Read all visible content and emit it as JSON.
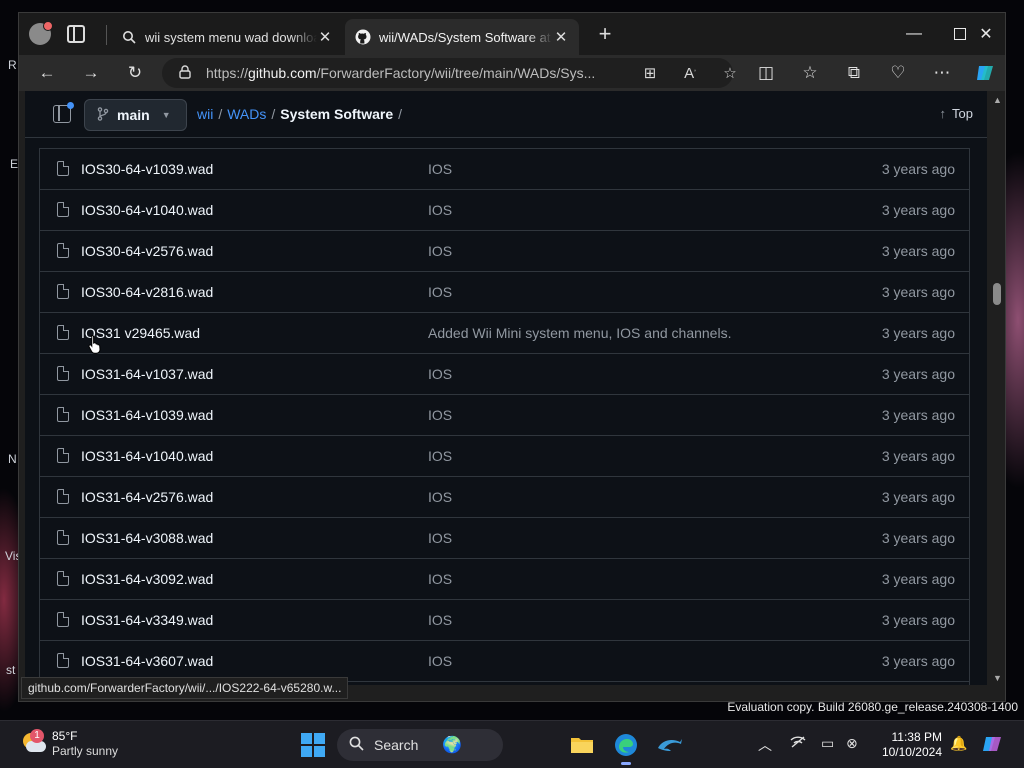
{
  "browser": {
    "tabs": [
      {
        "title": "wii system menu wad download -",
        "icon": "search-icon",
        "active": false
      },
      {
        "title": "wii/WADs/System Software at ma",
        "icon": "github-icon",
        "active": true
      }
    ],
    "address": {
      "url_prefix": "https://",
      "url_host": "github.com",
      "url_path": "/ForwarderFactory/wii/tree/main/WADs/Sys..."
    },
    "status_url": "github.com/ForwarderFactory/wii/.../IOS222-64-v65280.w..."
  },
  "repo_header": {
    "branch": "main",
    "breadcrumb": [
      "wii",
      "WADs",
      "System Software"
    ],
    "top_label": "Top"
  },
  "files": [
    {
      "name": "IOS30-64-v1039.wad",
      "message": "IOS",
      "age": "3 years ago"
    },
    {
      "name": "IOS30-64-v1040.wad",
      "message": "IOS",
      "age": "3 years ago"
    },
    {
      "name": "IOS30-64-v2576.wad",
      "message": "IOS",
      "age": "3 years ago"
    },
    {
      "name": "IOS30-64-v2816.wad",
      "message": "IOS",
      "age": "3 years ago"
    },
    {
      "name": "IOS31 v29465.wad",
      "message": "Added Wii Mini system menu, IOS and channels.",
      "age": "3 years ago"
    },
    {
      "name": "IOS31-64-v1037.wad",
      "message": "IOS",
      "age": "3 years ago"
    },
    {
      "name": "IOS31-64-v1039.wad",
      "message": "IOS",
      "age": "3 years ago"
    },
    {
      "name": "IOS31-64-v1040.wad",
      "message": "IOS",
      "age": "3 years ago"
    },
    {
      "name": "IOS31-64-v2576.wad",
      "message": "IOS",
      "age": "3 years ago"
    },
    {
      "name": "IOS31-64-v3088.wad",
      "message": "IOS",
      "age": "3 years ago"
    },
    {
      "name": "IOS31-64-v3092.wad",
      "message": "IOS",
      "age": "3 years ago"
    },
    {
      "name": "IOS31-64-v3349.wad",
      "message": "IOS",
      "age": "3 years ago"
    },
    {
      "name": "IOS31-64-v3607.wad",
      "message": "IOS",
      "age": "3 years ago"
    }
  ],
  "desktop": {
    "watermark": "Evaluation copy. Build 26080.ge_release.240308-1400"
  },
  "taskbar": {
    "weather_temp": "85°F",
    "weather_condition": "Partly sunny",
    "weather_badge": "1",
    "search_label": "Search",
    "time": "11:38 PM",
    "date": "10/10/2024"
  },
  "colors": {
    "page_bg": "#0d1117",
    "link": "#4493f8",
    "border": "#30363d",
    "muted": "#9198a1"
  }
}
